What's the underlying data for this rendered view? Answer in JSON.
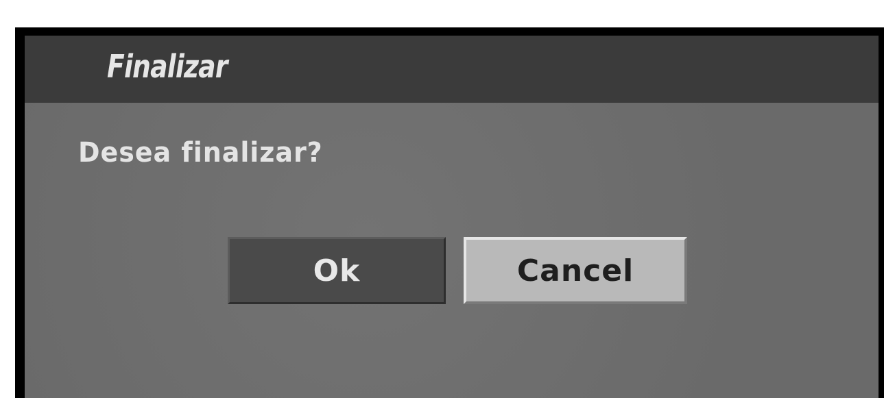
{
  "dialog": {
    "title": "Finalizar",
    "message": "Desea finalizar?",
    "buttons": {
      "ok_label": "Ok",
      "cancel_label": "Cancel"
    },
    "selected_button": "Cancel"
  },
  "colors": {
    "title_bar": "#3b3b3b",
    "dialog_body": "#6e6e6e",
    "button_default": "#4a4a4a",
    "button_selected": "#b9b9b9",
    "text_light": "#e6e6e6",
    "text_dark": "#1e1e1e"
  }
}
